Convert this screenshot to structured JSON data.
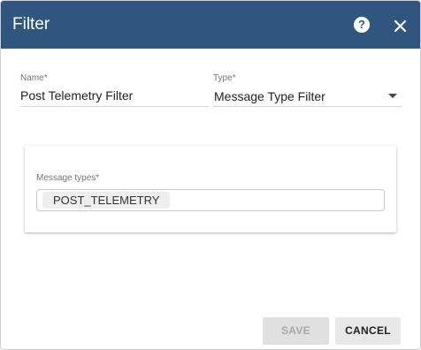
{
  "dialog": {
    "title": "Filter",
    "help_icon": "help-circle-icon",
    "close_icon": "close-icon",
    "header_color": "#305680"
  },
  "form": {
    "name": {
      "label": "Name",
      "required_mark": "*",
      "value": "Post Telemetry Filter"
    },
    "type": {
      "label": "Type",
      "required_mark": "*",
      "value": "Message Type Filter",
      "icon": "dropdown-arrow-icon"
    },
    "message_types": {
      "label": "Message types",
      "required_mark": "*",
      "chips": [
        "POST_TELEMETRY"
      ]
    }
  },
  "actions": {
    "save_label": "SAVE",
    "cancel_label": "CANCEL"
  }
}
